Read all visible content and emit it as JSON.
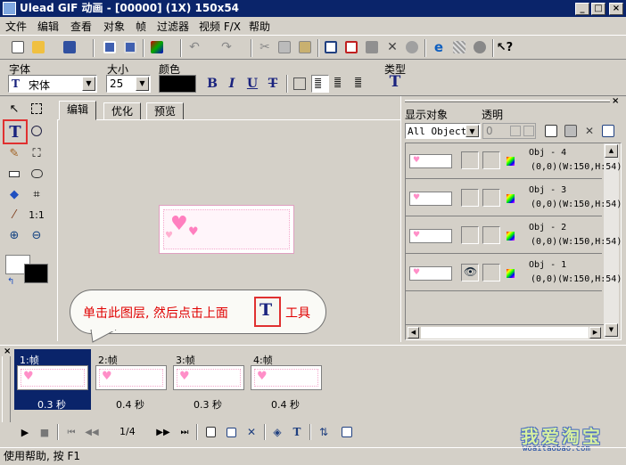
{
  "window": {
    "title": "Ulead GIF 动画 - [00000] (1X) 150x54",
    "minimize": "_",
    "maximize": "□",
    "close": "×"
  },
  "menu": [
    "文件",
    "编辑",
    "查看",
    "对象",
    "帧",
    "过滤器",
    "视频 F/X",
    "帮助"
  ],
  "format_bar": {
    "font_label": "字体",
    "font_value": "宋体",
    "size_label": "大小",
    "size_value": "25",
    "color_label": "颜色",
    "color_value": "#000000",
    "type_label": "类型",
    "bold": "B",
    "italic": "I",
    "underline": "U",
    "strike": "T",
    "type_icon": "T"
  },
  "tabs": [
    "编辑",
    "优化",
    "预览"
  ],
  "objects_panel": {
    "show_label": "显示对象",
    "filter_value": "All Objects",
    "transparency_label": "透明",
    "transparency_value": "0",
    "objects": [
      {
        "name": "Obj - 4",
        "info": "(0,0)(W:150,H:54)",
        "visible": false
      },
      {
        "name": "Obj - 3",
        "info": "(0,0)(W:150,H:54)",
        "visible": false
      },
      {
        "name": "Obj - 2",
        "info": "(0,0)(W:150,H:54)",
        "visible": false
      },
      {
        "name": "Obj - 1",
        "info": "(0,0)(W:150,H:54)",
        "visible": true
      }
    ]
  },
  "callout": {
    "text_before": "单击此图层, 然后点击上面",
    "text_after": "工具",
    "icon": "T"
  },
  "frames": [
    {
      "label": "1:帧",
      "delay": "0.3 秒",
      "selected": true
    },
    {
      "label": "2:帧",
      "delay": "0.4 秒",
      "selected": false
    },
    {
      "label": "3:帧",
      "delay": "0.3 秒",
      "selected": false
    },
    {
      "label": "4:帧",
      "delay": "0.4 秒",
      "selected": false
    }
  ],
  "playback": {
    "counter": "1/4"
  },
  "watermark": {
    "text": "我爱淘宝",
    "url": "woaitaobao.com"
  },
  "status": "使用帮助, 按 F1",
  "colors": {
    "titlebar": "#0a246a",
    "selection": "#0a246a",
    "callout_text": "#e00000",
    "highlight_box": "#e03030"
  }
}
